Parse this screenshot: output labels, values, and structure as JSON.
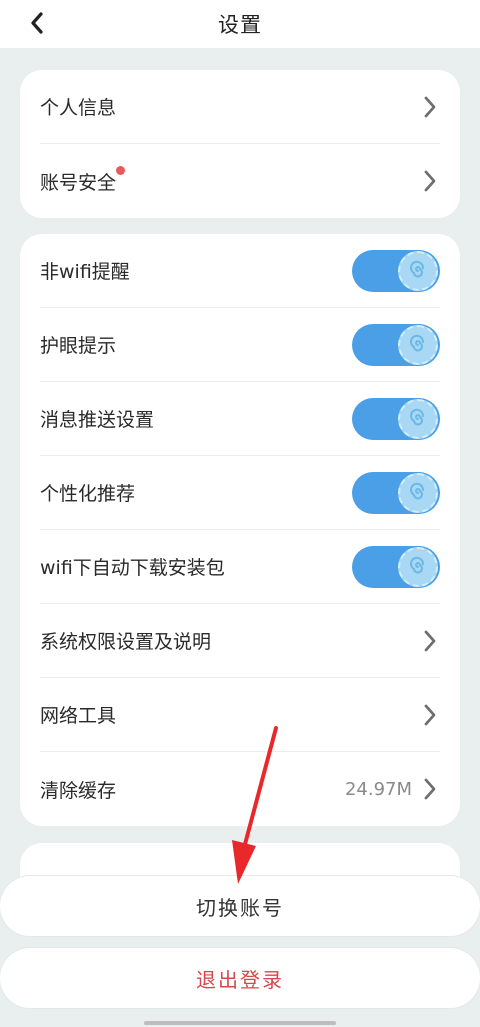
{
  "header": {
    "title": "设置",
    "back_icon": "chevron-left-icon"
  },
  "group1": {
    "items": [
      {
        "label": "个人信息",
        "has_dot": false
      },
      {
        "label": "账号安全",
        "has_dot": true
      }
    ]
  },
  "group2": {
    "toggles": [
      {
        "label": "非wifi提醒",
        "on": true
      },
      {
        "label": "护眼提示",
        "on": true
      },
      {
        "label": "消息推送设置",
        "on": true
      },
      {
        "label": "个性化推荐",
        "on": true
      },
      {
        "label": "wifi下自动下载安装包",
        "on": true
      }
    ],
    "links": [
      {
        "label": "系统权限设置及说明",
        "value": ""
      },
      {
        "label": "网络工具",
        "value": ""
      },
      {
        "label": "清除缓存",
        "value": "24.97M"
      }
    ]
  },
  "actions": {
    "switch_account": "切换账号",
    "logout": "退出登录"
  },
  "colors": {
    "toggle_on": "#4a9fe6",
    "logout_text": "#d04b4b",
    "dot": "#e55a5a",
    "annotation_arrow": "#e8282a"
  }
}
